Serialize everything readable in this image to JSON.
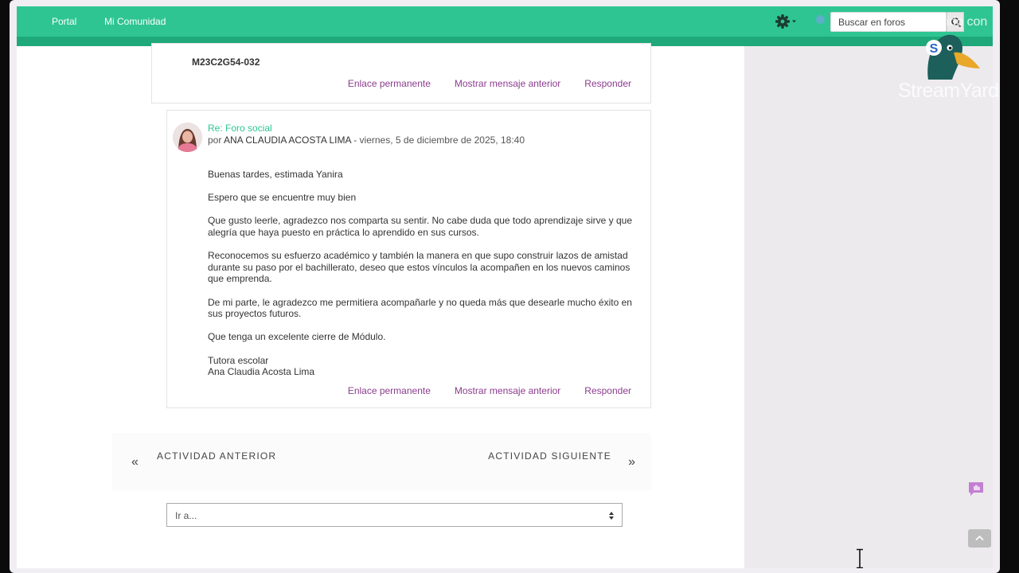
{
  "nav": {
    "links": [
      "Portal",
      "Mi Comunidad"
    ],
    "search_placeholder": "Buscar en foros",
    "icons": [
      "gear-icon",
      "search-icon"
    ]
  },
  "previous_post": {
    "course_code": "M23C2G54-032",
    "actions": [
      "Enlace permanente",
      "Mostrar mensaje anterior",
      "Responder"
    ]
  },
  "reply": {
    "subject": "Re: Foro social",
    "by_prefix": "por",
    "author": "ANA CLAUDIA ACOSTA LIMA",
    "date": "- viernes, 5 de diciembre de 2025, 18:40",
    "paragraphs": [
      "Buenas tardes, estimada Yanira",
      "Espero que se encuentre muy bien",
      "Que gusto leerle, agradezco nos comparta su sentir. No cabe duda que todo aprendizaje sirve y que alegría que haya puesto en práctica lo aprendido en sus cursos.",
      "Reconocemos su esfuerzo académico y también la manera en que supo construir lazos de amistad durante su paso por el bachillerato, deseo que estos vínculos la acompañen en los nuevos caminos que emprenda.",
      "De mi parte, le agradezco me permitiera acompañarle y no queda más que desearle mucho éxito en sus proyectos futuros.",
      "Que tenga un excelente cierre de Módulo."
    ],
    "signature": [
      "Tutora escolar",
      "Ana Claudia Acosta Lima"
    ],
    "actions": [
      "Enlace permanente",
      "Mostrar mensaje anterior",
      "Responder"
    ]
  },
  "activity_nav": {
    "prev_arrow": "«",
    "prev_label": "ACTIVIDAD ANTERIOR",
    "next_label": "ACTIVIDAD SIGUIENTE",
    "next_arrow": "»"
  },
  "jump_select": {
    "selected": "Ir a..."
  },
  "overlay": {
    "produced_text": "Producido con",
    "brand_letter": "S",
    "brand": "StreamYard"
  },
  "colors": {
    "navbar": "#2ec592",
    "navbar_band": "#1fa97a",
    "link": "#8b3c8e",
    "subject": "#2ec592"
  }
}
